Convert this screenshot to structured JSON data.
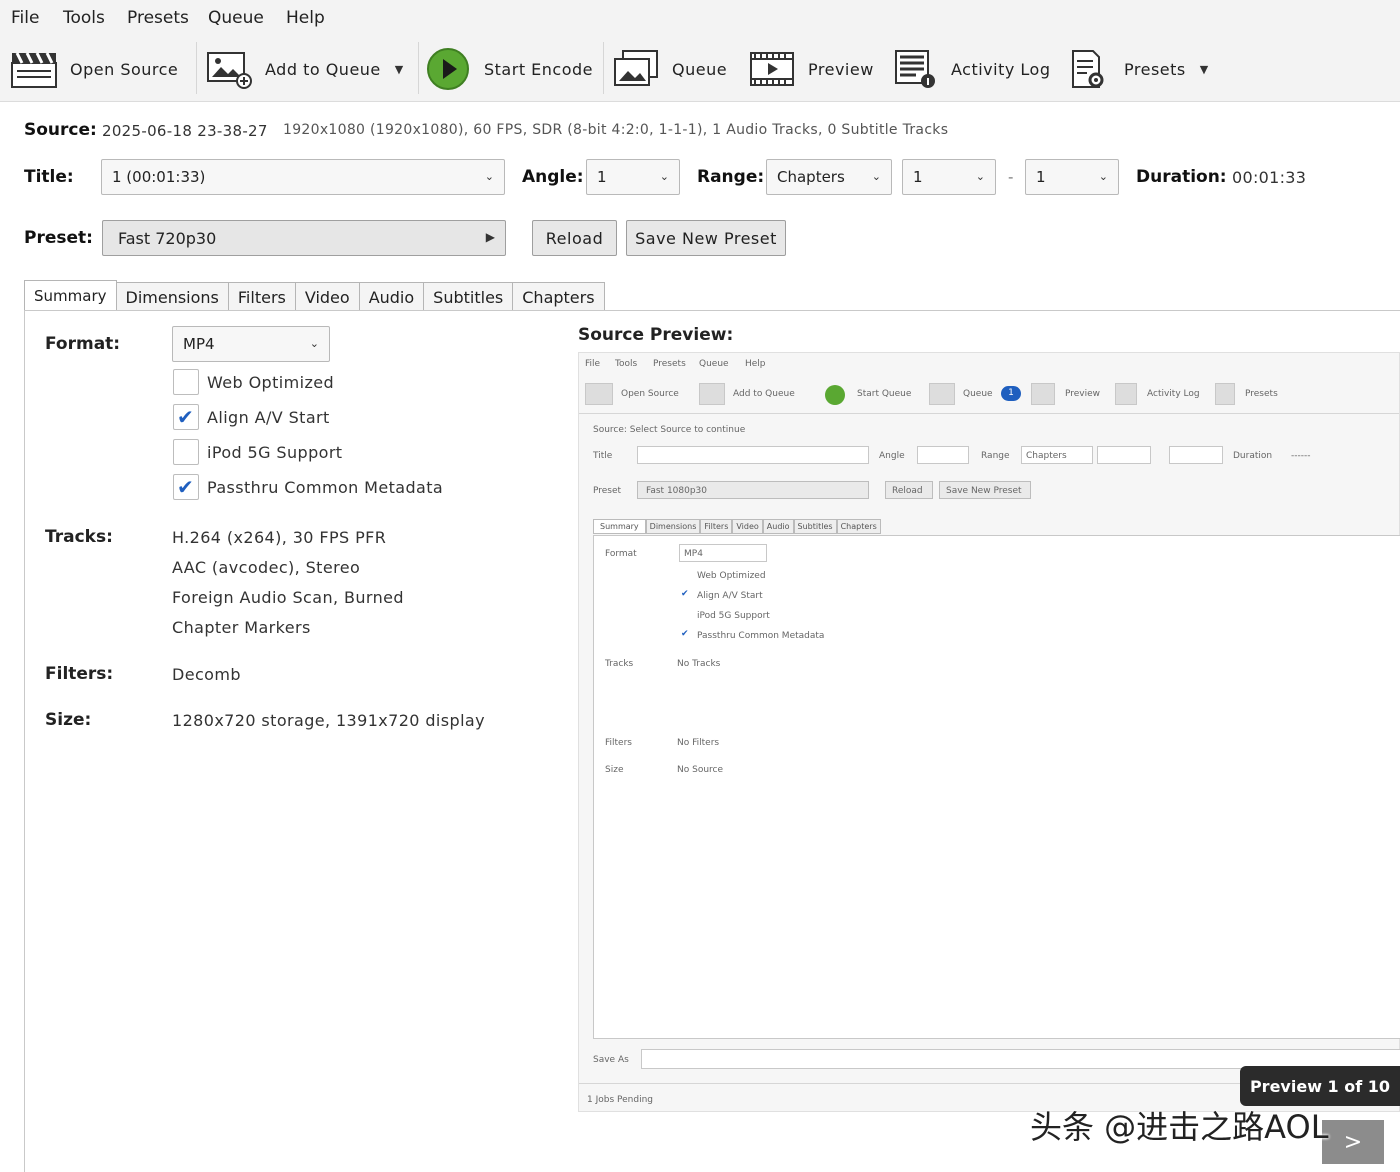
{
  "menu": [
    "File",
    "Tools",
    "Presets",
    "Queue",
    "Help"
  ],
  "toolbar": {
    "open_source": "Open Source",
    "add_to_queue": "Add to Queue",
    "start_encode": "Start Encode",
    "queue": "Queue",
    "preview": "Preview",
    "activity_log": "Activity Log",
    "presets": "Presets"
  },
  "source": {
    "label": "Source:",
    "name": "2025-06-18 23-38-27",
    "info": "1920x1080 (1920x1080), 60 FPS, SDR (8-bit 4:2:0, 1-1-1), 1 Audio Tracks, 0 Subtitle Tracks"
  },
  "title_row": {
    "title_label": "Title:",
    "title_value": "1  (00:01:33)",
    "angle_label": "Angle:",
    "angle_value": "1",
    "range_label": "Range:",
    "range_value": "Chapters",
    "range_start": "1",
    "range_sep": "-",
    "range_end": "1",
    "duration_label": "Duration:",
    "duration_value": "00:01:33"
  },
  "preset_row": {
    "label": "Preset:",
    "value": "Fast 720p30",
    "reload": "Reload",
    "save_new": "Save New Preset"
  },
  "tabs": [
    "Summary",
    "Dimensions",
    "Filters",
    "Video",
    "Audio",
    "Subtitles",
    "Chapters"
  ],
  "summary": {
    "format_label": "Format:",
    "format_value": "MP4",
    "options": [
      {
        "label": "Web Optimized",
        "checked": false
      },
      {
        "label": "Align A/V Start",
        "checked": true
      },
      {
        "label": "iPod 5G Support",
        "checked": false
      },
      {
        "label": "Passthru Common Metadata",
        "checked": true
      }
    ],
    "tracks_label": "Tracks:",
    "tracks": [
      "H.264 (x264), 30 FPS PFR",
      "AAC (avcodec), Stereo",
      "Foreign Audio Scan, Burned",
      "Chapter Markers"
    ],
    "filters_label": "Filters:",
    "filters_value": "Decomb",
    "size_label": "Size:",
    "size_value": "1280x720 storage, 1391x720 display"
  },
  "preview": {
    "heading": "Source Preview:",
    "badge": "Preview 1 of 10",
    "next": ">"
  },
  "mini": {
    "menu": [
      "File",
      "Tools",
      "Presets",
      "Queue",
      "Help"
    ],
    "toolbar": [
      "Open Source",
      "Add to Queue",
      "Start Queue",
      "Queue",
      "Preview",
      "Activity Log",
      "Presets"
    ],
    "queue_count": "1",
    "source": "Source:  Select Source to continue",
    "title": "Title",
    "angle": "Angle",
    "range": "Range",
    "range_value": "Chapters",
    "duration": "Duration",
    "duration_value": "------",
    "preset": "Preset",
    "preset_value": "Fast 1080p30",
    "reload": "Reload",
    "save_new": "Save New Preset",
    "tabs": [
      "Summary",
      "Dimensions",
      "Filters",
      "Video",
      "Audio",
      "Subtitles",
      "Chapters"
    ],
    "format": "Format",
    "format_value": "MP4",
    "options": [
      "Web Optimized",
      "Align A/V Start",
      "iPod 5G Support",
      "Passthru Common Metadata"
    ],
    "tracks": "Tracks",
    "tracks_value": "No Tracks",
    "filters": "Filters",
    "filters_value": "No Filters",
    "size": "Size",
    "size_value": "No Source",
    "save_as": "Save As",
    "status": "1 Jobs Pending"
  },
  "watermark": "头条 @进击之路AOL",
  "colors": {
    "play_green": "#5aa832",
    "check_blue": "#1f5fbf",
    "badge_bg": "#2b2b2b"
  }
}
